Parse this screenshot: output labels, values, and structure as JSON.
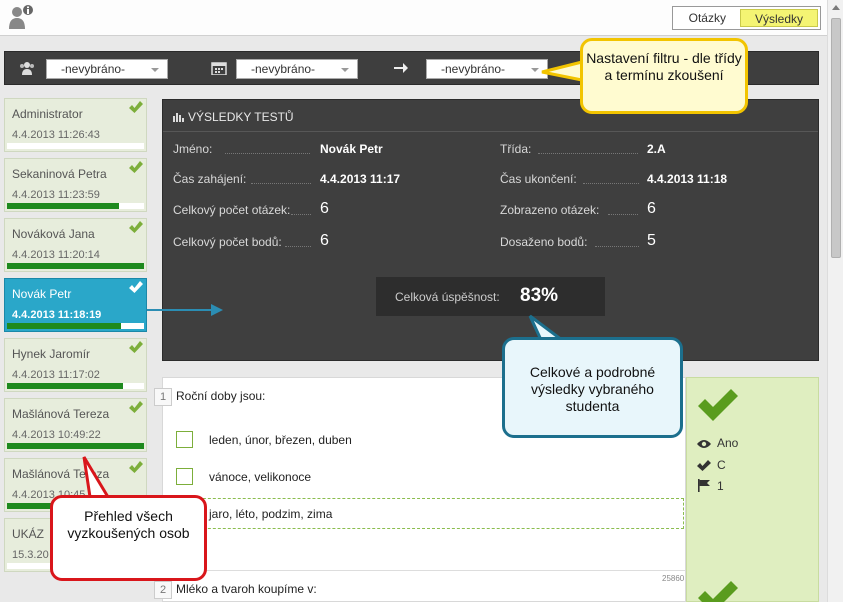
{
  "header": {
    "tabs": [
      {
        "label": "Otázky",
        "active": false
      },
      {
        "label": "Výsledky",
        "active": true
      }
    ]
  },
  "filters": {
    "group_icon": "users-icon",
    "date_icon": "calendar-icon",
    "arrow_icon": "arrow-right-icon",
    "class_select": "-nevybráno-",
    "date_select": "-nevybráno-",
    "term_select": "-nevybráno-"
  },
  "students": [
    {
      "name": "Administrator",
      "date": "4.4.2013 11:26:43",
      "progress": 0,
      "checked": true
    },
    {
      "name": "Sekaninová Petra",
      "date": "4.4.2013 11:23:59",
      "progress": 0.82,
      "checked": true
    },
    {
      "name": "Nováková Jana",
      "date": "4.4.2013 11:20:14",
      "progress": 1.0,
      "checked": true
    },
    {
      "name": "Novák Petr",
      "date": "4.4.2013 11:18:19",
      "progress": 0.83,
      "checked": true,
      "selected": true
    },
    {
      "name": "Hynek Jaromír",
      "date": "4.4.2013 11:17:02",
      "progress": 0.85,
      "checked": true
    },
    {
      "name": "Mašlánová Tereza",
      "date": "4.4.2013 10:49:22",
      "progress": 1.0,
      "checked": true
    },
    {
      "name": "Mašlánová Tereza",
      "date": "4.4.2013 10:45",
      "progress": 0.68,
      "checked": true
    },
    {
      "name": "UKÁZ",
      "date": "15.3.20",
      "progress": 0,
      "checked": false
    }
  ],
  "results": {
    "title": "VÝSLEDKY TESTŮ",
    "name_label": "Jméno:",
    "name_value": "Novák Petr",
    "class_label": "Třída:",
    "class_value": "2.A",
    "start_label": "Čas zahájení:",
    "start_value": "4.4.2013 11:17",
    "end_label": "Čas ukončení:",
    "end_value": "4.4.2013 11:18",
    "questions_total_label": "Celkový počet otázek:",
    "questions_total_value": "6",
    "questions_shown_label": "Zobrazeno otázek:",
    "questions_shown_value": "6",
    "points_total_label": "Celkový počet bodů:",
    "points_total_value": "6",
    "points_reached_label": "Dosaženo bodů:",
    "points_reached_value": "5",
    "success_label": "Celková úspěšnost:",
    "success_value": "83%"
  },
  "question1": {
    "number": "1",
    "text": "Roční doby jsou:",
    "answers": [
      "leden, únor, březen, duben",
      "vánoce, velikonoce",
      "jaro, léto, podzim, zima"
    ],
    "id": "25860"
  },
  "question2": {
    "number": "2",
    "text": "Mléko a tvaroh koupíme v:"
  },
  "side_info": {
    "visible": "Ano",
    "answer": "C",
    "points": "1"
  },
  "callouts": {
    "filter": "Nastavení filtru - dle třídy a termínu zkoušení",
    "detail": "Celkové a podrobné výsledky vybraného studenta",
    "overview": "Přehled všech vyzkoušených osob"
  },
  "colors": {
    "accent_tab": "#f4f473",
    "selected_student": "#2aa7c9",
    "progress": "#1e8a1e",
    "check": "#7cae3a"
  }
}
